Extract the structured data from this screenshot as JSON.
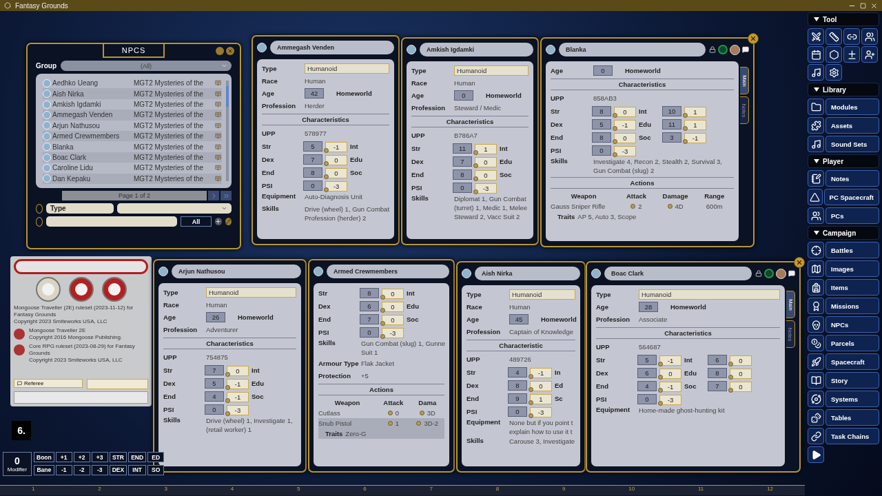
{
  "app_title": "Fantasy Grounds",
  "npc_list": {
    "title": "NPCS",
    "group_label": "Group",
    "group_value": "(All)",
    "rows": [
      {
        "name": "Aedhko Ueang",
        "source": "MGT2 Mysteries of the"
      },
      {
        "name": "Aish Nirka",
        "source": "MGT2 Mysteries of the"
      },
      {
        "name": "Amkish Igdamki",
        "source": "MGT2 Mysteries of the"
      },
      {
        "name": "Ammegash Venden",
        "source": "MGT2 Mysteries of the"
      },
      {
        "name": "Arjun Nathusou",
        "source": "MGT2 Mysteries of the"
      },
      {
        "name": "Armed Crewmembers",
        "source": "MGT2 Mysteries of the"
      },
      {
        "name": "Blanka",
        "source": "MGT2 Mysteries of the"
      },
      {
        "name": "Boac Clark",
        "source": "MGT2 Mysteries of the"
      },
      {
        "name": "Caroline Lidu",
        "source": "MGT2 Mysteries of the"
      },
      {
        "name": "Dan Kepaku",
        "source": "MGT2 Mysteries of the"
      }
    ],
    "page": "Page 1 of 2",
    "filter_label": "Type",
    "all_button": "All"
  },
  "windows": [
    {
      "name": "Ammegash Venden",
      "header_icons": false,
      "closable": false,
      "rows": [
        {
          "kind": "input",
          "label": "Type",
          "value": "Humanoid"
        },
        {
          "kind": "field",
          "label": "Race",
          "value": "Human"
        },
        {
          "kind": "age",
          "label": "Age",
          "value": "42",
          "extra": "Homeworld"
        },
        {
          "kind": "field",
          "label": "Profession",
          "value": "Herder"
        },
        {
          "kind": "heading",
          "text": "Characteristics"
        },
        {
          "kind": "field",
          "label": "UPP",
          "value": "578977"
        },
        {
          "kind": "stats",
          "rows": [
            {
              "label": "Str",
              "score": "5",
              "mod": "-1",
              "label2": "Int"
            },
            {
              "label": "Dex",
              "score": "7",
              "mod": "0",
              "label2": "Edu"
            },
            {
              "label": "End",
              "score": "8",
              "mod": "0",
              "label2": "Soc"
            },
            {
              "label": "PSI",
              "score": "0",
              "mod": "-3"
            }
          ]
        },
        {
          "kind": "text",
          "label": "Equipment",
          "value": "Auto-Diagnosis Unit"
        },
        {
          "kind": "text",
          "label": "Skills",
          "value": "Drive (wheel) 1, Gun Combat\nProfession (herder) 2"
        }
      ]
    },
    {
      "name": "Amkish Igdamki",
      "header_icons": false,
      "closable": false,
      "rows": [
        {
          "kind": "input",
          "label": "Type",
          "value": "Humanoid"
        },
        {
          "kind": "field",
          "label": "Race",
          "value": "Human"
        },
        {
          "kind": "age",
          "label": "Age",
          "value": "0",
          "extra": "Homeworld"
        },
        {
          "kind": "field",
          "label": "Profession",
          "value": "Steward / Medic"
        },
        {
          "kind": "heading",
          "text": "Characteristics"
        },
        {
          "kind": "field",
          "label": "UPP",
          "value": "B786A7"
        },
        {
          "kind": "stats",
          "rows": [
            {
              "label": "Str",
              "score": "11",
              "mod": "1",
              "label2": "Int"
            },
            {
              "label": "Dex",
              "score": "7",
              "mod": "0",
              "label2": "Edu"
            },
            {
              "label": "End",
              "score": "8",
              "mod": "0",
              "label2": "Soc"
            },
            {
              "label": "PSI",
              "score": "0",
              "mod": "-3"
            }
          ]
        },
        {
          "kind": "text",
          "label": "Skills",
          "value": "Diplomat 1, Gun Combat\n(turret) 1, Medic 1, Melee\nSteward 2, Vacc Suit 2"
        }
      ]
    },
    {
      "name": "Blanka",
      "header_icons": true,
      "closable": true,
      "tabs": [
        {
          "label": "Main",
          "selected": true
        },
        {
          "label": "Notes",
          "selected": false
        }
      ],
      "rows": [
        {
          "kind": "age",
          "label": "Age",
          "value": "0",
          "extra": "Homeworld"
        },
        {
          "kind": "heading",
          "text": "Characteristics"
        },
        {
          "kind": "field",
          "label": "UPP",
          "value": "858AB3"
        },
        {
          "kind": "stats",
          "rows": [
            {
              "label": "Str",
              "score": "8",
              "mod": "0",
              "label2": "Int",
              "score2": "10",
              "mod2": "1"
            },
            {
              "label": "Dex",
              "score": "5",
              "mod": "-1",
              "label2": "Edu",
              "score2": "11",
              "mod2": "1"
            },
            {
              "label": "End",
              "score": "8",
              "mod": "0",
              "label2": "Soc",
              "score2": "3",
              "mod2": "-1"
            },
            {
              "label": "PSI",
              "score": "0",
              "mod": "-3"
            }
          ]
        },
        {
          "kind": "text",
          "label": "Skills",
          "value": "Investigate 4, Recon 2, Stealth 2, Survival 3,\nGun Combat (slug) 2"
        },
        {
          "kind": "heading",
          "text": "Actions"
        },
        {
          "kind": "weapons",
          "columns": [
            "Weapon",
            "Attack",
            "Damage",
            "Range"
          ],
          "rows": [
            {
              "cells": [
                "Gauss Sniper Rifle",
                "2",
                "4D",
                "600m"
              ],
              "traits_label": "Traits",
              "traits": "AP 5, Auto 3, Scope",
              "selected": false
            }
          ]
        }
      ]
    },
    {
      "name": "Arjun Nathusou",
      "header_icons": false,
      "closable": false,
      "rows": [
        {
          "kind": "input",
          "label": "Type",
          "value": "Humanoid"
        },
        {
          "kind": "field",
          "label": "Race",
          "value": "Human"
        },
        {
          "kind": "age",
          "label": "Age",
          "value": "26",
          "extra": "Homeworld"
        },
        {
          "kind": "field",
          "label": "Profession",
          "value": "Adventurer"
        },
        {
          "kind": "heading",
          "text": "Characteristics"
        },
        {
          "kind": "field",
          "label": "UPP",
          "value": "754875"
        },
        {
          "kind": "stats",
          "rows": [
            {
              "label": "Str",
              "score": "7",
              "mod": "0",
              "label2": "Int"
            },
            {
              "label": "Dex",
              "score": "5",
              "mod": "-1",
              "label2": "Edu"
            },
            {
              "label": "End",
              "score": "4",
              "mod": "-1",
              "label2": "Soc"
            },
            {
              "label": "PSI",
              "score": "0",
              "mod": "-3"
            }
          ]
        },
        {
          "kind": "text",
          "label": "Skills",
          "value": "Drive (wheel) 1, Investigate 1,\n(retail worker) 1"
        }
      ]
    },
    {
      "name": "Armed Crewmembers",
      "header_icons": false,
      "closable": false,
      "rows": [
        {
          "kind": "stats",
          "rows": [
            {
              "label": "Str",
              "score": "8",
              "mod": "0",
              "label2": "Int"
            },
            {
              "label": "Dex",
              "score": "6",
              "mod": "0",
              "label2": "Edu"
            },
            {
              "label": "End",
              "score": "7",
              "mod": "0",
              "label2": "Soc"
            },
            {
              "label": "PSI",
              "score": "0",
              "mod": "-3"
            }
          ]
        },
        {
          "kind": "text",
          "label": "Skills",
          "value": "Gun Combat (slug) 1, Gunne\nSuit 1"
        },
        {
          "kind": "field",
          "label": "Armour Type",
          "value": "Flak Jacket"
        },
        {
          "kind": "field",
          "label": "Protection",
          "value": "+5"
        },
        {
          "kind": "heading",
          "text": "Actions"
        },
        {
          "kind": "weapons",
          "columns": [
            "Weapon",
            "Attack",
            "Dama"
          ],
          "rows": [
            {
              "cells": [
                "Cutlass",
                "0",
                "3D"
              ],
              "selected": false
            },
            {
              "cells": [
                "Snub Pistol",
                "1",
                "3D-2"
              ],
              "traits_label": "Traits",
              "traits": "Zero-G",
              "selected": true
            }
          ]
        }
      ]
    },
    {
      "name": "Aish Nirka",
      "header_icons": false,
      "closable": false,
      "rows": [
        {
          "kind": "input",
          "label": "Type",
          "value": "Humanoid"
        },
        {
          "kind": "field",
          "label": "Race",
          "value": "Human"
        },
        {
          "kind": "age",
          "label": "Age",
          "value": "45",
          "extra": "Homeworld"
        },
        {
          "kind": "field",
          "label": "Profession",
          "value": "Captain of Knowledge"
        },
        {
          "kind": "heading",
          "text": "Characteristic"
        },
        {
          "kind": "field",
          "label": "UPP",
          "value": "489726"
        },
        {
          "kind": "stats",
          "rows": [
            {
              "label": "Str",
              "score": "4",
              "mod": "-1",
              "label2": "In"
            },
            {
              "label": "Dex",
              "score": "8",
              "mod": "0",
              "label2": "Ed"
            },
            {
              "label": "End",
              "score": "9",
              "mod": "1",
              "label2": "Sc"
            },
            {
              "label": "PSI",
              "score": "0",
              "mod": "-3"
            }
          ]
        },
        {
          "kind": "text",
          "label": "Equipment",
          "value": "None but if you point t\nexplain how to use it t"
        },
        {
          "kind": "text",
          "label": "Skills",
          "value": "Carouse 3, Investigate"
        }
      ]
    },
    {
      "name": "Boac Clark",
      "header_icons": true,
      "closable": true,
      "tabs": [
        {
          "label": "Main",
          "selected": true
        },
        {
          "label": "Notes",
          "selected": false
        }
      ],
      "rows": [
        {
          "kind": "input",
          "label": "Type",
          "value": "Humanoid"
        },
        {
          "kind": "age",
          "label": "Age",
          "value": "28",
          "extra": "Homeworld"
        },
        {
          "kind": "field",
          "label": "Profession",
          "value": "Associate"
        },
        {
          "kind": "heading",
          "text": "Characteristics"
        },
        {
          "kind": "field",
          "label": "UPP",
          "value": "564687"
        },
        {
          "kind": "stats",
          "rows": [
            {
              "label": "Str",
              "score": "5",
              "mod": "-1",
              "label2": "Int",
              "score2": "6",
              "mod2": "0"
            },
            {
              "label": "Dex",
              "score": "6",
              "mod": "0",
              "label2": "Edu",
              "score2": "8",
              "mod2": "0"
            },
            {
              "label": "End",
              "score": "4",
              "mod": "-1",
              "label2": "Soc",
              "score2": "7",
              "mod2": "0"
            },
            {
              "label": "PSI",
              "score": "0",
              "mod": "-3"
            }
          ]
        },
        {
          "kind": "text",
          "label": "Equipment",
          "value": "Home-made ghost-hunting kit"
        }
      ]
    }
  ],
  "ruleset_info": [
    {
      "text": "Mongoose Traveller (2E) ruleset (2023-11-12) for Fantasy Grounds\nCopyright 2023 Smiteworks USA, LLC",
      "icon": false
    },
    {
      "text": "Mongoose Traveller 2E\nCopyright 2016 Mongoose Publishing.",
      "icon": true
    },
    {
      "text": "Core RPG ruleset (2023-08-29) for Fantasy Grounds\nCopyright 2023 Smiteworks USA, LLC",
      "icon": true
    }
  ],
  "chat": {
    "identity": "Referee"
  },
  "dice_tray": "6.",
  "modifier": {
    "value": "0",
    "label": "Modifier",
    "row1": [
      "Boon",
      "+1",
      "+2",
      "+3",
      "STR",
      "END",
      "ED"
    ],
    "row2": [
      "Bane",
      "-1",
      "-2",
      "-3",
      "DEX",
      "INT",
      "SO"
    ]
  },
  "ruler": [
    "1",
    "2",
    "3",
    "4",
    "5",
    "6",
    "7",
    "8",
    "9",
    "10",
    "11",
    "12"
  ],
  "sidebar": [
    {
      "title": "Tool",
      "expanded": true,
      "kind": "grid"
    },
    {
      "title": "Library",
      "expanded": true,
      "kind": "list",
      "items": [
        "Modules",
        "Assets",
        "Sound Sets"
      ]
    },
    {
      "title": "Player",
      "expanded": true,
      "kind": "list",
      "items": [
        "Notes",
        "PC Spacecraft",
        "PCs"
      ]
    },
    {
      "title": "Campaign",
      "expanded": true,
      "kind": "list",
      "items": [
        "Battles",
        "Images",
        "Items",
        "Missions",
        "NPCs",
        "Parcels",
        "Spacecraft",
        "Story",
        "Systems",
        "Tables",
        "Task Chains"
      ]
    }
  ]
}
